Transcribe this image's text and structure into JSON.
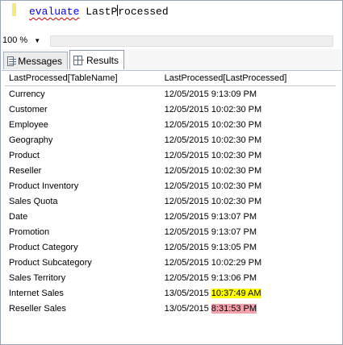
{
  "editor": {
    "keyword": "evaluate",
    "code_before_caret": "LastP",
    "code_after_caret": "rocessed"
  },
  "zoom": {
    "value": "100 %"
  },
  "tabs": [
    {
      "label": "Messages",
      "icon": "messages-icon"
    },
    {
      "label": "Results",
      "icon": "grid-icon"
    }
  ],
  "table": {
    "columns": [
      "LastProcessed[TableName]",
      "LastProcessed[LastProcessed]"
    ],
    "rows": [
      {
        "name": "Currency",
        "date": "12/05/2015",
        "time": "9:13:09 PM"
      },
      {
        "name": "Customer",
        "date": "12/05/2015",
        "time": "10:02:30 PM"
      },
      {
        "name": "Employee",
        "date": "12/05/2015",
        "time": "10:02:30 PM"
      },
      {
        "name": "Geography",
        "date": "12/05/2015",
        "time": "10:02:30 PM"
      },
      {
        "name": "Product",
        "date": "12/05/2015",
        "time": "10:02:30 PM"
      },
      {
        "name": "Reseller",
        "date": "12/05/2015",
        "time": "10:02:30 PM"
      },
      {
        "name": "Product Inventory",
        "date": "12/05/2015",
        "time": "10:02:30 PM"
      },
      {
        "name": "Sales Quota",
        "date": "12/05/2015",
        "time": "10:02:30 PM"
      },
      {
        "name": "Date",
        "date": "12/05/2015",
        "time": "9:13:07 PM"
      },
      {
        "name": "Promotion",
        "date": "12/05/2015",
        "time": "9:13:07 PM"
      },
      {
        "name": "Product Category",
        "date": "12/05/2015",
        "time": "9:13:05 PM"
      },
      {
        "name": "Product Subcategory",
        "date": "12/05/2015",
        "time": "10:02:29 PM"
      },
      {
        "name": "Sales Territory",
        "date": "12/05/2015",
        "time": "9:13:06 PM"
      },
      {
        "name": "Internet Sales",
        "date": "13/05/2015",
        "time": "10:37:49 AM",
        "highlight": "yellow"
      },
      {
        "name": "Reseller Sales",
        "date": "13/05/2015",
        "time": "8:31:53 PM",
        "highlight": "red"
      }
    ]
  },
  "colors": {
    "keyword": "#0000ff",
    "highlight_yellow": "#ffff00",
    "highlight_red": "#f4a3ad"
  }
}
